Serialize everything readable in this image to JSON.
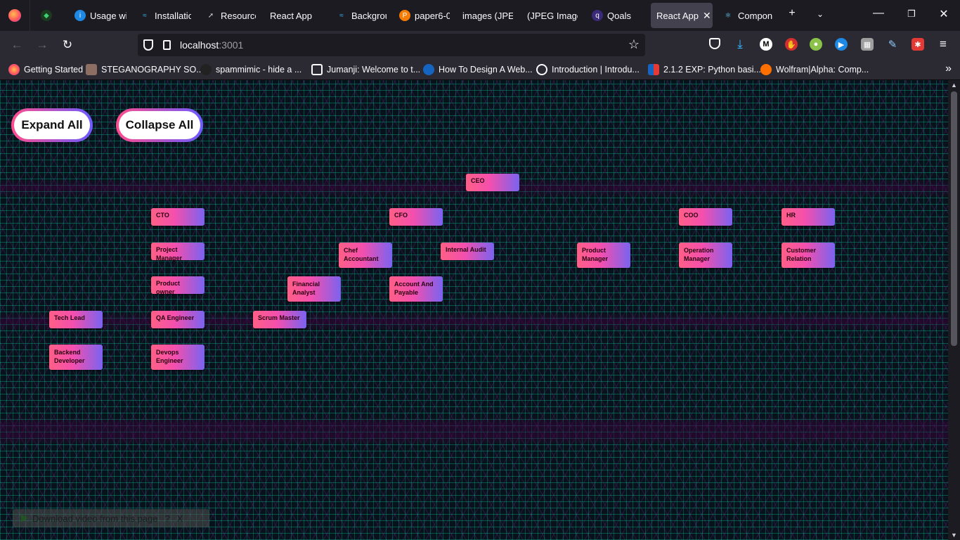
{
  "tabs": [
    {
      "label": "",
      "icon": "leaf-icon",
      "color": "#2e7d32"
    },
    {
      "label": "Usage wi",
      "icon": "info-icon",
      "color": "#1e88e5"
    },
    {
      "label": "Installatio",
      "icon": "tailwind-icon",
      "color": "#38bdf8"
    },
    {
      "label": "Resource",
      "icon": "rocket-icon",
      "color": "#9e9e9e"
    },
    {
      "label": "React App",
      "icon": "",
      "color": ""
    },
    {
      "label": "Backgrou",
      "icon": "tailwind-icon",
      "color": "#38bdf8"
    },
    {
      "label": "paper6-0",
      "icon": "paper-icon",
      "color": "#f57c00"
    },
    {
      "label": "images (JPEG",
      "icon": "",
      "color": ""
    },
    {
      "label": "(JPEG Image,",
      "icon": "",
      "color": ""
    },
    {
      "label": "Qoals",
      "icon": "qoals-icon",
      "color": "#3b2a7a"
    },
    {
      "label": "React App",
      "icon": "",
      "color": "",
      "active": true
    },
    {
      "label": "Compon",
      "icon": "react-icon",
      "color": "#61dafb"
    }
  ],
  "url": {
    "host": "localhost",
    "port": ":3001"
  },
  "bookmarks": [
    {
      "label": "Getting Started",
      "icon": "firefox-icon"
    },
    {
      "label": "STEGANOGRAPHY SO...",
      "icon": "eye-icon"
    },
    {
      "label": "spammimic - hide a ...",
      "icon": "mask-icon"
    },
    {
      "label": "Jumanji: Welcome to t...",
      "icon": "image-icon"
    },
    {
      "label": "How To Design A Web...",
      "icon": "k-icon"
    },
    {
      "label": "Introduction | Introdu...",
      "icon": "globe-icon"
    },
    {
      "label": "2.1.2 EXP: Python basi...",
      "icon": "book-icon"
    },
    {
      "label": "Wolfram|Alpha: Comp...",
      "icon": "wolfram-icon"
    }
  ],
  "buttons": {
    "expand": "Expand All",
    "collapse": "Collapse All"
  },
  "nodes": [
    {
      "label": "CEO"
    },
    {
      "label": "CTO"
    },
    {
      "label": "CFO"
    },
    {
      "label": "COO"
    },
    {
      "label": "HR"
    },
    {
      "label": "Project Manager"
    },
    {
      "label": "Chef Accountant"
    },
    {
      "label": "Internal Audit"
    },
    {
      "label": "Product Manager"
    },
    {
      "label": "Operation Manager"
    },
    {
      "label": "Customer Relation"
    },
    {
      "label": "Product owner"
    },
    {
      "label": "Financial Analyst"
    },
    {
      "label": "Account And Payable"
    },
    {
      "label": "Tech Lead"
    },
    {
      "label": "QA Engineer"
    },
    {
      "label": "Scrum Master"
    },
    {
      "label": "Backend Developer"
    },
    {
      "label": "Devops Engineer"
    }
  ],
  "download_bar": {
    "label": "Download video from this page",
    "help": "?",
    "close": "X"
  }
}
